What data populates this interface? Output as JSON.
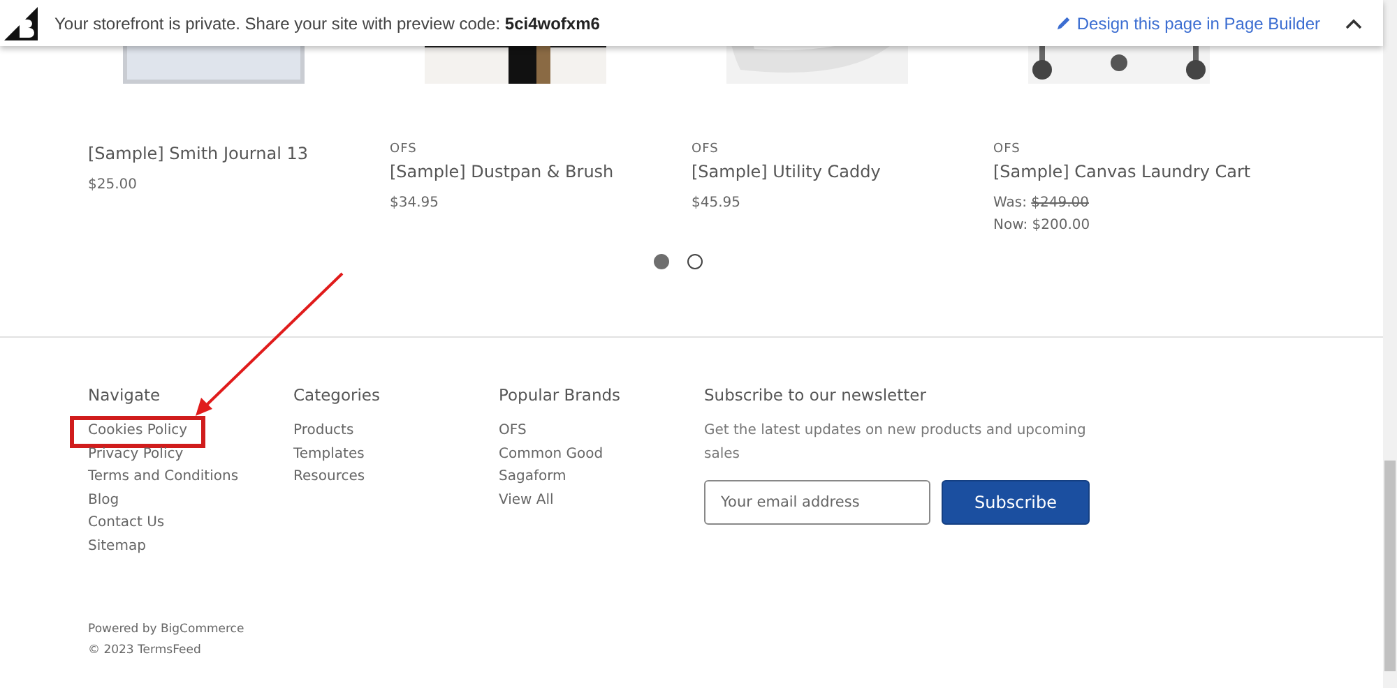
{
  "banner": {
    "message": "Your storefront is private. Share your site with preview code:",
    "code": "5ci4wofxm6",
    "link": "Design this page in Page Builder"
  },
  "products": [
    {
      "name": "[Sample] Smith Journal 13",
      "kind": "regular",
      "price": "$25.00"
    },
    {
      "brand": "OFS",
      "name": "[Sample] Dustpan & Brush",
      "kind": "regular",
      "price": "$34.95"
    },
    {
      "brand": "OFS",
      "name": "[Sample] Utility Caddy",
      "kind": "regular",
      "price": "$45.95"
    },
    {
      "brand": "OFS",
      "name": "[Sample] Canvas Laundry Cart",
      "kind": "sale",
      "was_label": "Was:",
      "was_price": "$249.00",
      "now": "Now: $200.00"
    }
  ],
  "carousel_dots": [
    {
      "selected": true
    },
    {
      "selected": false
    }
  ],
  "footer": {
    "columns": [
      {
        "heading": "Navigate",
        "links": [
          {
            "label": "Cookies Policy",
            "highlighted": true
          },
          {
            "label": "Privacy Policy",
            "highlighted": false
          },
          {
            "label": "Terms and Conditions",
            "highlighted": false
          },
          {
            "label": "Blog",
            "highlighted": false
          },
          {
            "label": "Contact Us",
            "highlighted": false
          },
          {
            "label": "Sitemap",
            "highlighted": false
          }
        ]
      },
      {
        "heading": "Categories",
        "links": [
          {
            "label": "Products",
            "highlighted": false
          },
          {
            "label": "Templates",
            "highlighted": false
          },
          {
            "label": "Resources",
            "highlighted": false
          }
        ]
      },
      {
        "heading": "Popular Brands",
        "links": [
          {
            "label": "OFS",
            "highlighted": false
          },
          {
            "label": "Common Good",
            "highlighted": false
          },
          {
            "label": "Sagaform",
            "highlighted": false
          },
          {
            "label": "View All",
            "highlighted": false
          }
        ]
      }
    ],
    "newsletter": {
      "heading": "Subscribe to our newsletter",
      "text": "Get the latest updates on new products and upcoming sales",
      "placeholder": "Your email address",
      "button": "Subscribe"
    },
    "powered_by": "Powered by BigCommerce",
    "copyright": "© 2023 TermsFeed"
  }
}
